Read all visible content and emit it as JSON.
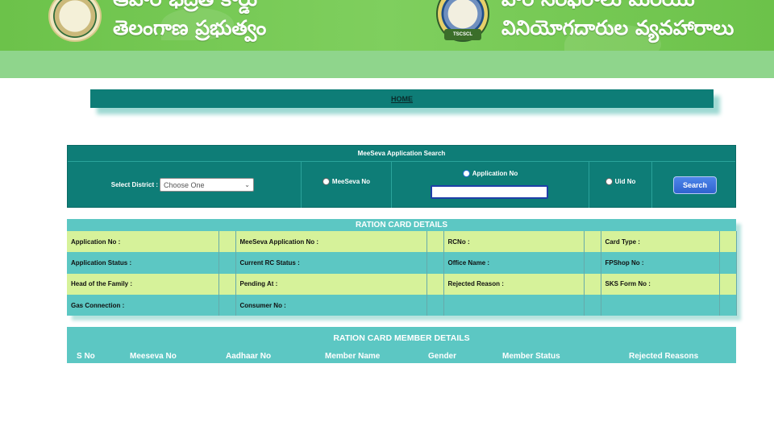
{
  "header": {
    "left_title_top": "ఆహార భద్రత కార్డు",
    "left_title": "తెలంగాణ ప్రభుత్వం",
    "right_title_top": "పౌర సరఫరాలు మరియు",
    "right_title": "వినియోగదారుల వ్యవహారాలు",
    "right_emblem_text": "TSCSCL"
  },
  "nav": {
    "home_label": "HOME"
  },
  "search": {
    "title": "MeeSeva Application Search",
    "district_label": "Select District :",
    "district_value": "Choose One",
    "radio_meeseva": "MeeSeva No",
    "radio_application": "Application No",
    "radio_uid": "Uid No",
    "search_button": "Search"
  },
  "ration_card": {
    "title": "RATION CARD DETAILS",
    "rows": [
      [
        "Application No :",
        "MeeSeva Application No :",
        "RCNo :",
        "Card Type :"
      ],
      [
        "Application Status :",
        "Current RC Status :",
        "Office Name :",
        "FPShop No :"
      ],
      [
        "Head of the Family :",
        "Pending At :",
        "Rejected Reason :",
        "SKS Form No :"
      ],
      [
        "Gas Connection :",
        "Consumer No :",
        "",
        ""
      ]
    ]
  },
  "members": {
    "title": "RATION CARD MEMBER DETAILS",
    "columns": [
      "S No",
      "Meeseva No",
      "Aadhaar No",
      "Member Name",
      "Gender",
      "Member Status",
      "Rejected Reasons"
    ]
  },
  "colors": {
    "banner_green": "#6cc24a",
    "dark_teal": "#0e7d77",
    "light_teal": "#5cc7c3",
    "lime": "#d6f29a",
    "button_blue": "#2f63cf"
  }
}
